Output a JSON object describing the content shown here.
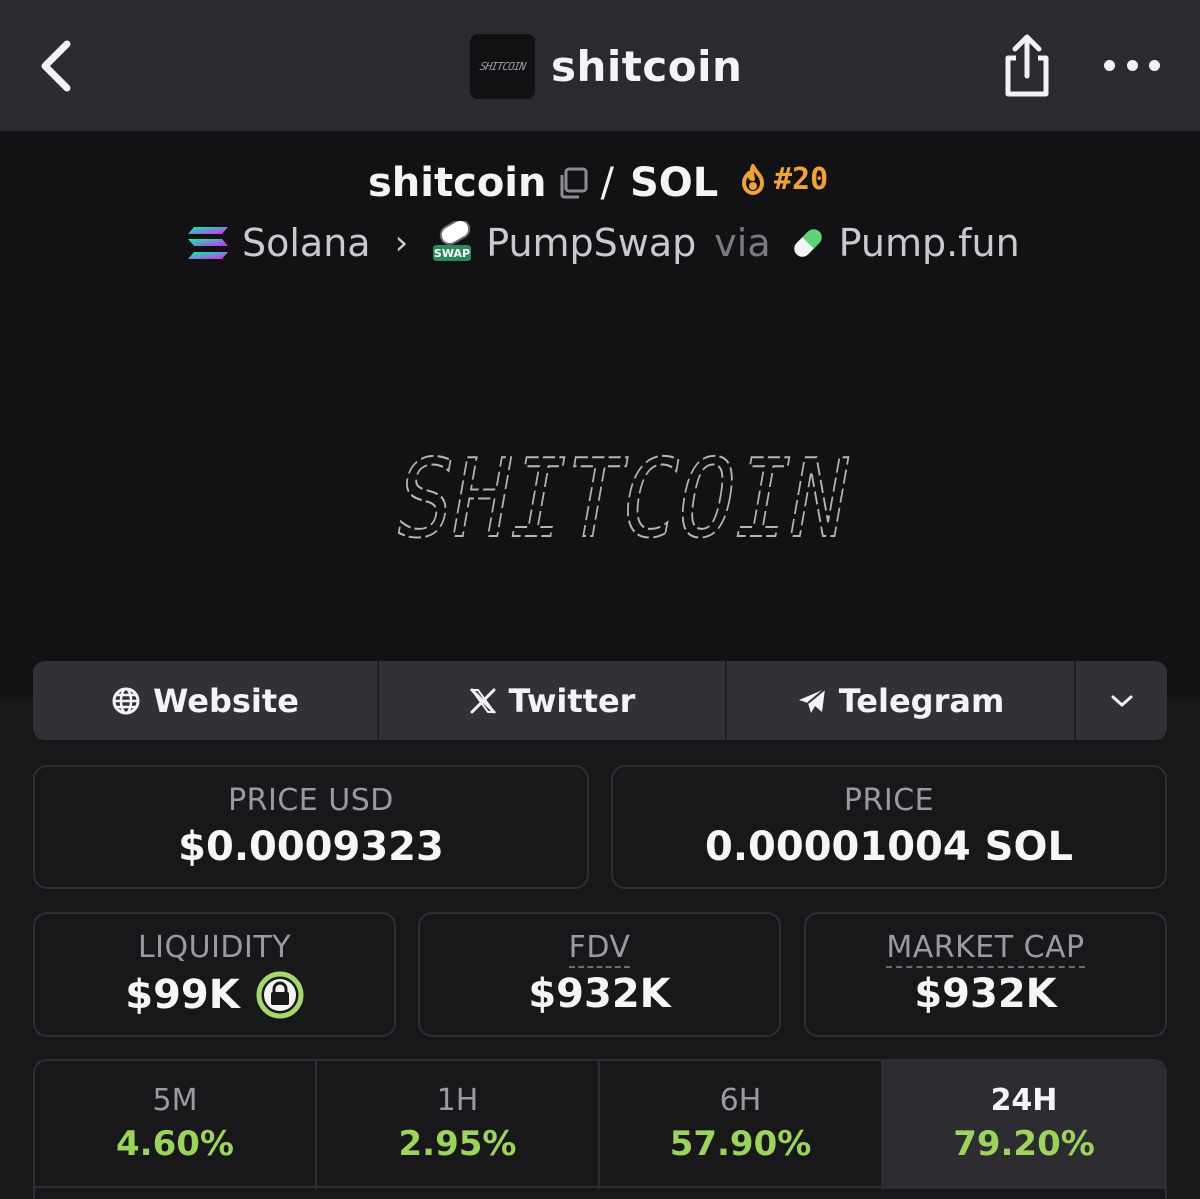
{
  "nav": {
    "title": "shitcoin",
    "logo_text": "SHITCOIN",
    "back_icon": "chevron-left-icon",
    "share_icon": "share-icon",
    "more_icon": "more-horizontal-icon"
  },
  "pair": {
    "base": "shitcoin",
    "separator": "/",
    "quote": "SOL",
    "rank": "#20"
  },
  "chain": {
    "chain_name": "Solana",
    "dex_name": "PumpSwap",
    "via": "via",
    "launchpad": "Pump.fun",
    "dex_badge": "SWAP"
  },
  "banner": {
    "text": "SHITCOIN"
  },
  "links": {
    "website": "Website",
    "twitter": "Twitter",
    "telegram": "Telegram"
  },
  "stats": {
    "price_usd_label": "PRICE USD",
    "price_usd": "$0.0009323",
    "price_label": "PRICE",
    "price": "0.00001004 SOL",
    "liquidity_label": "LIQUIDITY",
    "liquidity": "$99K",
    "fdv_label": "FDV",
    "fdv": "$932K",
    "mcap_label": "MARKET CAP",
    "mcap": "$932K"
  },
  "timeframes": [
    {
      "label": "5M",
      "change": "4.60%"
    },
    {
      "label": "1H",
      "change": "2.95%"
    },
    {
      "label": "6H",
      "change": "57.90%"
    },
    {
      "label": "24H",
      "change": "79.20%"
    }
  ],
  "colors": {
    "accent_orange": "#f0a23a",
    "positive_green": "#9bd35c",
    "lock_green": "#a5d86a"
  }
}
